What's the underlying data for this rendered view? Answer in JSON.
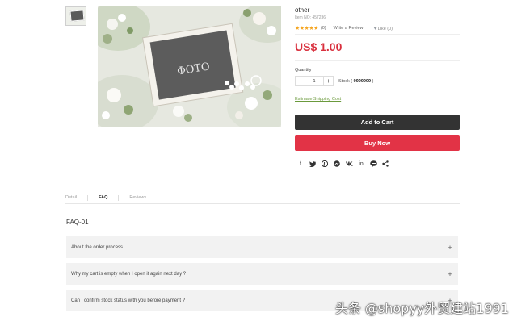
{
  "gallery": {
    "photo_text": "ΦΟΤΟ"
  },
  "product": {
    "title": "other",
    "sku": "Item NO: 457236",
    "stars": "★★★★★",
    "review_count": "(0)",
    "write_review": "Write a Review",
    "like_label": "Like (0)",
    "price": "US$ 1.00",
    "quantity_label": "Quantity",
    "quantity_value": "1",
    "stock_label": "Stock (",
    "stock_value": "9999999",
    "stock_close": ")",
    "shipping_link": "Estimate Shipping Cost",
    "add_to_cart": "Add to Cart",
    "buy_now": "Buy Now"
  },
  "share_icons": [
    "facebook-icon",
    "twitter-icon",
    "pinterest-icon",
    "messenger-icon",
    "vk-icon",
    "linkedin-icon",
    "line-icon",
    "share-icon"
  ],
  "tabs": [
    {
      "label": "Detail"
    },
    {
      "label": "FAQ"
    },
    {
      "label": "Reviews"
    }
  ],
  "faq": {
    "title": "FAQ-01",
    "items": [
      {
        "question": "About the order process"
      },
      {
        "question": "Why my cart is empty when I open it again next day ?"
      },
      {
        "question": "Can I confirm stock status with you before payment ?"
      }
    ]
  },
  "watermark": "头条 @shopyy外贸建站1991",
  "colors": {
    "price": "#d9303e",
    "cart_button": "#333333",
    "buy_button": "#e23346",
    "link": "#6b9a3d",
    "stars": "#f5a623"
  }
}
